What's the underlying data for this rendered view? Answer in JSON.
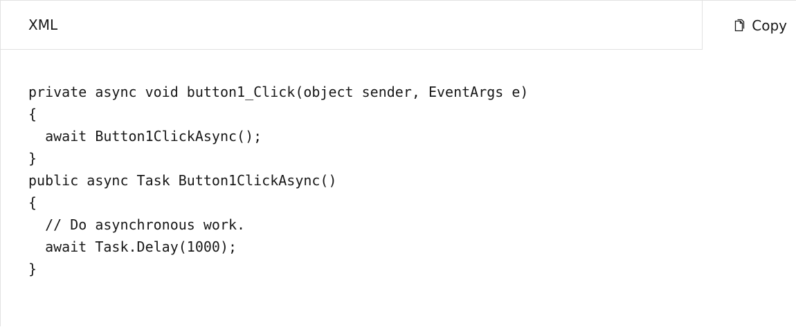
{
  "header": {
    "language_label": "XML",
    "copy_label": "Copy",
    "copy_icon": "copy-icon"
  },
  "code": {
    "lines": [
      "private async void button1_Click(object sender, EventArgs e)",
      "{",
      "  await Button1ClickAsync();",
      "}",
      "public async Task Button1ClickAsync()",
      "{",
      "  // Do asynchronous work.",
      "  await Task.Delay(1000);",
      "}"
    ]
  },
  "colors": {
    "text": "#171717",
    "border": "#e1e1e1",
    "background": "#ffffff"
  }
}
